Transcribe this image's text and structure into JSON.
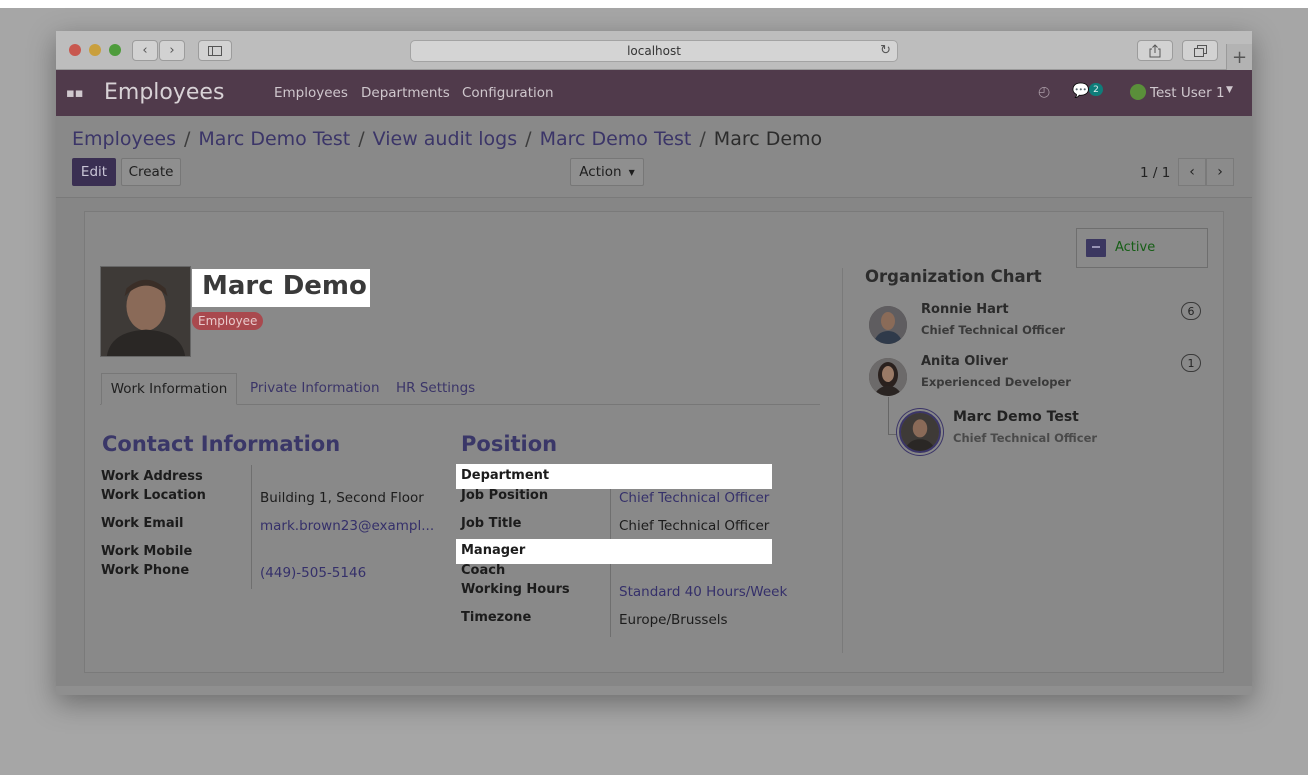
{
  "browser": {
    "url": "localhost"
  },
  "app": {
    "title": "Employees",
    "menu": [
      "Employees",
      "Departments",
      "Configuration"
    ],
    "chat_count": "2",
    "user": "Test User 1"
  },
  "breadcrumb": {
    "items": [
      "Employees",
      "Marc Demo Test",
      "View audit logs",
      "Marc Demo Test"
    ],
    "current": "Marc Demo",
    "separator": "/"
  },
  "toolbar": {
    "edit": "Edit",
    "create": "Create",
    "action": "Action",
    "pager": "1 / 1"
  },
  "status": {
    "active": "Active"
  },
  "employee": {
    "name": "Marc Demo",
    "tag": "Employee"
  },
  "tabs": [
    "Work Information",
    "Private Information",
    "HR Settings"
  ],
  "contact": {
    "title": "Contact Information",
    "work_address_label": "Work Address",
    "work_location_label": "Work Location",
    "work_location": "Building 1, Second Floor",
    "work_email_label": "Work Email",
    "work_email": "mark.brown23@exampl...",
    "work_mobile_label": "Work Mobile",
    "work_phone_label": "Work Phone",
    "work_phone": "(449)-505-5146"
  },
  "position": {
    "title": "Position",
    "department_label": "Department",
    "job_position_label": "Job Position",
    "job_position": "Chief Technical Officer",
    "job_title_label": "Job Title",
    "job_title": "Chief Technical Officer",
    "manager_label": "Manager",
    "coach_label": "Coach",
    "working_hours_label": "Working Hours",
    "working_hours": "Standard 40 Hours/Week",
    "timezone_label": "Timezone",
    "timezone": "Europe/Brussels"
  },
  "org_chart": {
    "title": "Organization Chart",
    "people": [
      {
        "name": "Ronnie Hart",
        "job": "Chief Technical Officer",
        "count": "6"
      },
      {
        "name": "Anita Oliver",
        "job": "Experienced Developer",
        "count": "1"
      },
      {
        "name": "Marc Demo Test",
        "job": "Chief Technical Officer"
      }
    ]
  },
  "colors": {
    "nav_bg": "#503a4b",
    "primary": "#3b3568",
    "tag_bg": "#a9494e",
    "active_text": "#165e16"
  }
}
